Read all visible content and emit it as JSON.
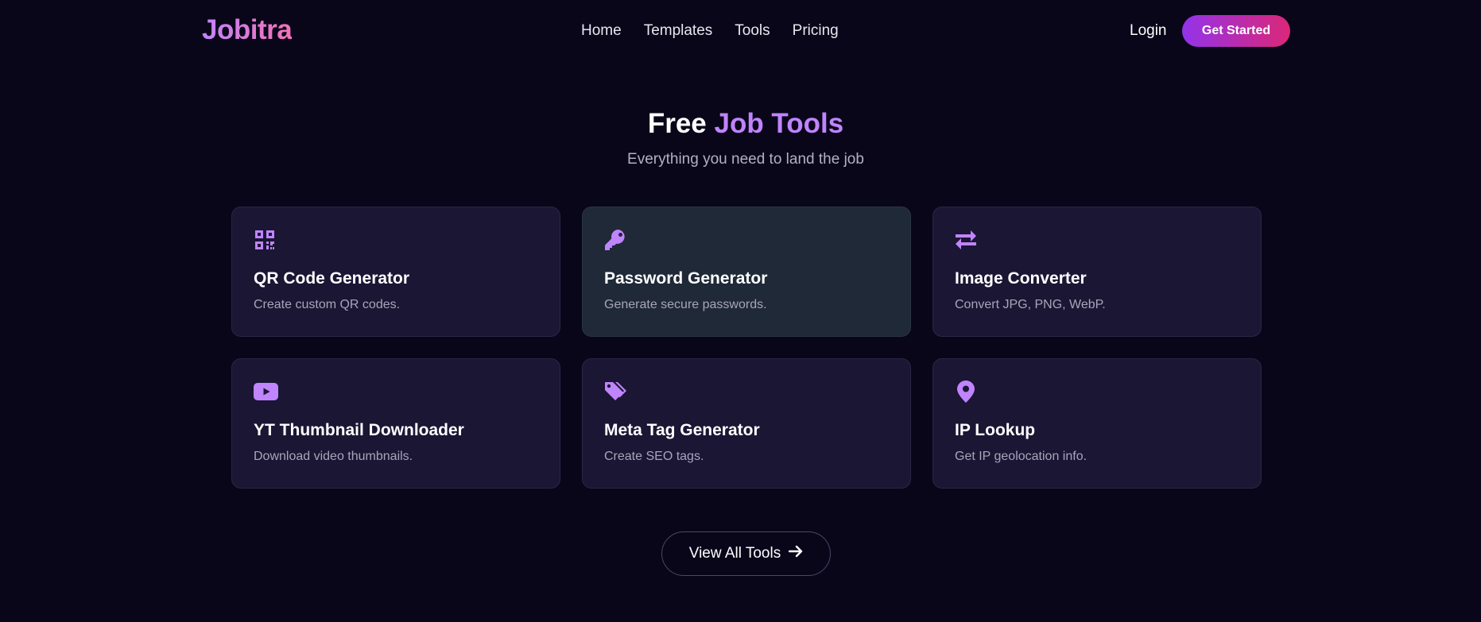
{
  "nav": {
    "logo": "Jobitra",
    "links": [
      "Home",
      "Templates",
      "Tools",
      "Pricing"
    ],
    "login": "Login",
    "cta": "Get Started"
  },
  "hero": {
    "title_plain": "Free ",
    "title_accent": "Job Tools",
    "subtitle": "Everything you need to land the job"
  },
  "accent_color": "#c084fc",
  "tools": [
    {
      "icon": "qr-code-icon",
      "title": "QR Code Generator",
      "desc": "Create custom QR codes."
    },
    {
      "icon": "key-icon",
      "title": "Password Generator",
      "desc": "Generate secure passwords."
    },
    {
      "icon": "arrows-exchange-icon",
      "title": "Image Converter",
      "desc": "Convert JPG, PNG, WebP."
    },
    {
      "icon": "youtube-icon",
      "title": "YT Thumbnail Downloader",
      "desc": "Download video thumbnails."
    },
    {
      "icon": "tags-icon",
      "title": "Meta Tag Generator",
      "desc": "Create SEO tags."
    },
    {
      "icon": "map-pin-icon",
      "title": "IP Lookup",
      "desc": "Get IP geolocation info."
    }
  ],
  "view_all": "View All Tools"
}
